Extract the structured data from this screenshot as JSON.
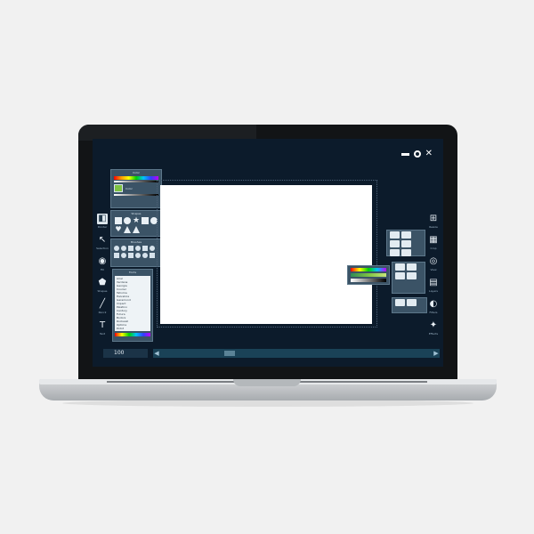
{
  "window": {
    "controls": {
      "minimize_icon": "minimize-icon",
      "maximize_icon": "maximize-icon",
      "close_label": "✕"
    }
  },
  "left_rail": [
    {
      "id": "pointer",
      "glyph": "◧",
      "label": "Pointer"
    },
    {
      "id": "select",
      "glyph": "↖",
      "label": "Selection"
    },
    {
      "id": "fill",
      "glyph": "◉",
      "label": "Fill"
    },
    {
      "id": "shapes",
      "glyph": "⬟",
      "label": "Shapes"
    },
    {
      "id": "pencil",
      "glyph": "╱",
      "label": "Pencil"
    },
    {
      "id": "text",
      "glyph": "T",
      "label": "Text"
    }
  ],
  "right_rail": [
    {
      "id": "resize",
      "glyph": "⊞",
      "label": "Resize"
    },
    {
      "id": "crop",
      "glyph": "▦",
      "label": "Crop"
    },
    {
      "id": "view",
      "glyph": "◎",
      "label": "View"
    },
    {
      "id": "layers",
      "glyph": "▤",
      "label": "Layers"
    },
    {
      "id": "filters",
      "glyph": "◐",
      "label": "Filters"
    },
    {
      "id": "effects",
      "glyph": "✦",
      "label": "Effects"
    }
  ],
  "panels": {
    "color": {
      "title": "Color",
      "swatch_primary": "#7ec242",
      "swatch_label": "Color"
    },
    "shapes": {
      "title": "Shapes"
    },
    "brushes": {
      "title": "Brushes"
    },
    "fonts": {
      "title": "Fonts",
      "items": [
        "Arial",
        "Verdana",
        "Georgia",
        "Courier",
        "Tahoma",
        "Helvetica",
        "Garamond",
        "Impact",
        "Palatino",
        "Century",
        "Futura",
        "Bodoni",
        "Rockwell",
        "Optima",
        "Didot"
      ]
    }
  },
  "bottom_bar": {
    "zoom_value": "100",
    "scroll_left": "◀",
    "scroll_right": "▶"
  },
  "colors": {
    "screen_bg": "#0c1b2b",
    "panel_bg": "#3b5366",
    "canvas": "#ffffff"
  }
}
